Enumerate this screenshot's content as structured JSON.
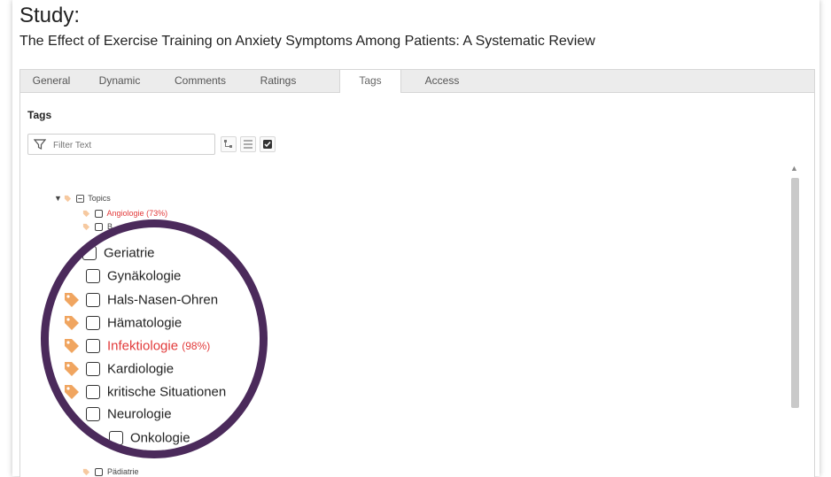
{
  "study": {
    "label": "Study:",
    "title": "The Effect of Exercise Training on Anxiety Symptoms Among Patients: A Systematic Review"
  },
  "tabs": [
    {
      "label": "General",
      "active": false
    },
    {
      "label": "Dynamic",
      "active": false
    },
    {
      "label": "Comments",
      "active": false
    },
    {
      "label": "Ratings",
      "active": false
    },
    {
      "label": "Tags",
      "active": true
    },
    {
      "label": "Access",
      "active": false
    }
  ],
  "tags_section": {
    "heading": "Tags",
    "filter_placeholder": "Filter Text"
  },
  "tree": {
    "root": "Topics",
    "small_items": [
      {
        "label": "Angiologie",
        "pct": "(73%)",
        "highlight": true
      },
      {
        "label": "B",
        "pct": "",
        "highlight": false
      }
    ],
    "bottom_item": {
      "label": "Pädiatrie"
    }
  },
  "zoom_items": [
    {
      "label": "Geriatrie",
      "pct": "",
      "highlight": false,
      "tagged": false
    },
    {
      "label": "Gynäkologie",
      "pct": "",
      "highlight": false,
      "tagged": false
    },
    {
      "label": "Hals-Nasen-Ohren",
      "pct": "",
      "highlight": false,
      "tagged": true
    },
    {
      "label": "Hämatologie",
      "pct": "",
      "highlight": false,
      "tagged": true
    },
    {
      "label": "Infektiologie",
      "pct": "(98%)",
      "highlight": true,
      "tagged": true
    },
    {
      "label": "Kardiologie",
      "pct": "",
      "highlight": false,
      "tagged": true
    },
    {
      "label": "kritische Situationen",
      "pct": "",
      "highlight": false,
      "tagged": true
    },
    {
      "label": "Neurologie",
      "pct": "",
      "highlight": false,
      "tagged": false
    },
    {
      "label": "Onkologie",
      "pct": "",
      "highlight": false,
      "tagged": true
    }
  ],
  "colors": {
    "highlight": "#e23a3a",
    "magnifier_ring": "#4b2a5b",
    "tag_icon": "#f0a560"
  }
}
